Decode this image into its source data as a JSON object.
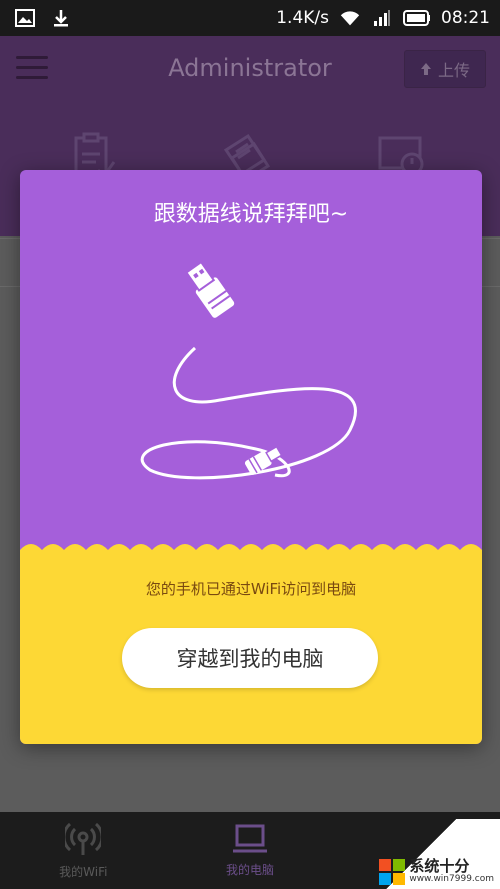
{
  "status_bar": {
    "speed": "1.4K/s",
    "time": "08:21",
    "icons": [
      "image-icon",
      "download-icon",
      "wifi-icon",
      "signal-icon",
      "battery-icon"
    ]
  },
  "app_bar": {
    "title": "Administrator",
    "upload_label": "上传",
    "icons": [
      "menu-icon",
      "clipboard-icon",
      "files-icon",
      "computer-icon"
    ]
  },
  "dialog": {
    "title": "跟数据线说拜拜吧~",
    "subtitle": "您的手机已通过WiFi访问到电脑",
    "button_label": "穿越到我的电脑",
    "colors": {
      "purple": "#a55fda",
      "yellow": "#fdd835"
    }
  },
  "bottom_nav": {
    "items": [
      {
        "label": "我的WiFi",
        "icon": "wifi-broadcast-icon"
      },
      {
        "label": "我的电脑",
        "icon": "laptop-icon"
      }
    ]
  },
  "watermark": {
    "title": "系统十分",
    "url": "www.win7999.com"
  }
}
